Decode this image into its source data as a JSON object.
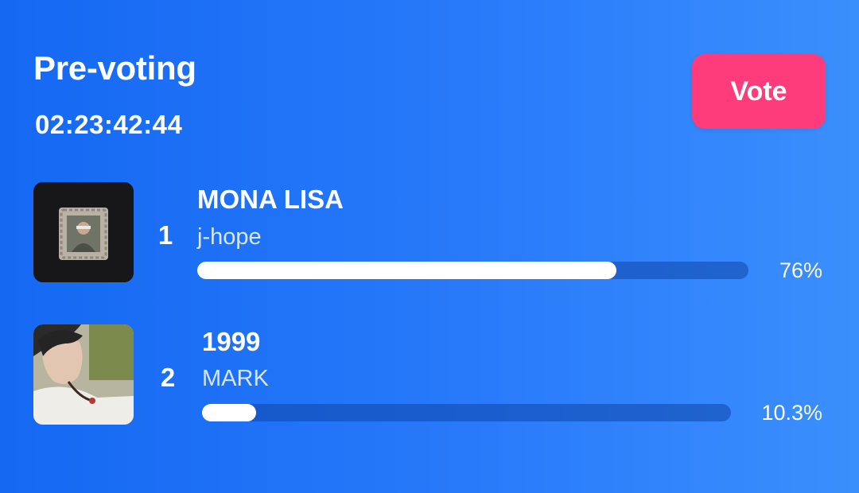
{
  "header": {
    "title": "Pre-voting",
    "countdown": "02:23:42:44",
    "vote_label": "Vote"
  },
  "colors": {
    "background_start": "#1468f2",
    "background_end": "#3b8ffc",
    "vote_button": "#fe3b7b",
    "bar_fill": "#ffffff",
    "bar_track": "#0e46aa"
  },
  "entries": [
    {
      "rank": "1",
      "song": "MONA LISA",
      "artist": "j-hope",
      "percent_label": "76%",
      "percent": 76,
      "cover_icon": "framed-portrait-artwork"
    },
    {
      "rank": "2",
      "song": "1999",
      "artist": "MARK",
      "percent_label": "10.3%",
      "percent": 10.3,
      "cover_icon": "portrait-photo-artwork"
    }
  ]
}
